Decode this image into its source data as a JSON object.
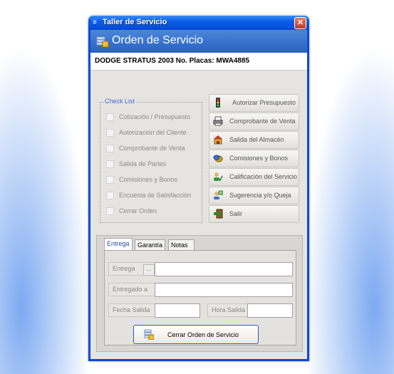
{
  "window": {
    "title": "Taller de Servicio",
    "close_symbol": "✕"
  },
  "header": {
    "title": "Orden de Servicio"
  },
  "vehicle": {
    "label": "DODGE STRATUS 2003 No. Placas: MWA4885"
  },
  "checklist": {
    "legend": "Check List",
    "items": [
      "Cotización / Presupuesto",
      "Autorización del Cliente",
      "Comprobante de Venta",
      "Salida de Partes",
      "Comisiones y Bonos",
      "Encuesta de Satisfacción",
      "Cerrar Orden"
    ]
  },
  "actions": [
    {
      "label": "Autorizar Presupuesto",
      "icon": "traffic-light-icon"
    },
    {
      "label": "Comprobante de Venta",
      "icon": "printer-icon"
    },
    {
      "label": "Salida del Almacén",
      "icon": "warehouse-icon"
    },
    {
      "label": "Comisiones y Bonos",
      "icon": "coins-icon"
    },
    {
      "label": "Calificación del Servicio",
      "icon": "user-rating-icon"
    },
    {
      "label": "Sugerencia y/o Queja",
      "icon": "user-comment-icon"
    },
    {
      "label": "Salir",
      "icon": "exit-door-icon"
    }
  ],
  "tabs": [
    "Entrega",
    "Garantía",
    "Notas Finales"
  ],
  "form": {
    "entrega_label": "Entrega",
    "ellipsis": "...",
    "entregado_label": "Entregado a",
    "fecha_label": "Fecha Salida",
    "hora_label": "Hora Salida"
  },
  "footer": {
    "close_order_label": "Cerrar Orden de Servicio"
  },
  "colors": {
    "accent": "#2a61c2",
    "legend": "#3a6bd2"
  }
}
